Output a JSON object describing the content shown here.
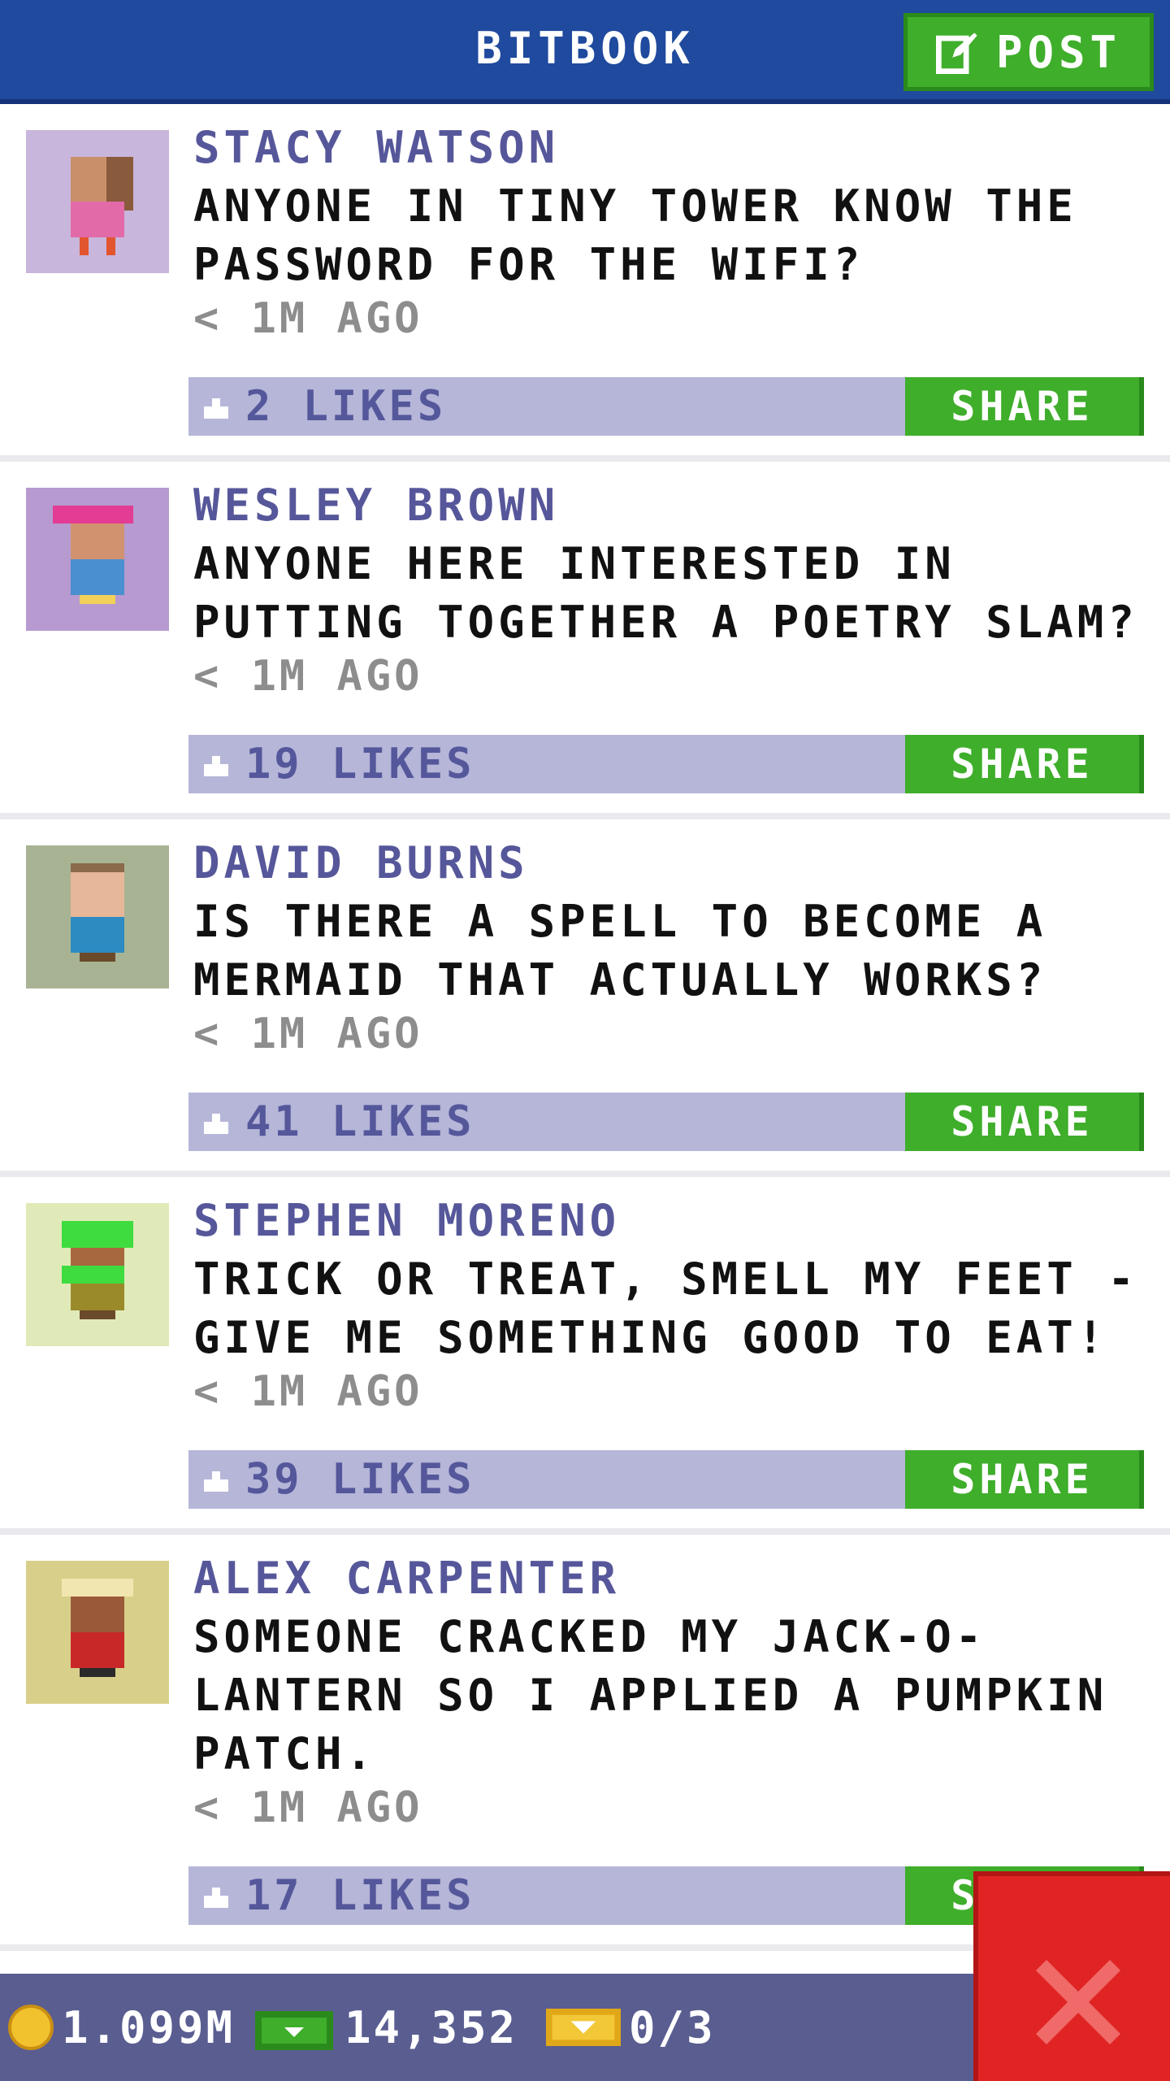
{
  "header": {
    "title": "BITBOOK",
    "post_label": "POST"
  },
  "posts": [
    {
      "author": "STACY WATSON",
      "message": "ANYONE IN TINY TOWER KNOW THE PASSWORD FOR THE WIFI?",
      "time": "< 1M AGO",
      "likes": "2 LIKES",
      "share_label": "SHARE"
    },
    {
      "author": "WESLEY BROWN",
      "message": "ANYONE HERE INTERESTED IN PUTTING TOGETHER A POETRY SLAM?",
      "time": "< 1M AGO",
      "likes": "19 LIKES",
      "share_label": "SHARE"
    },
    {
      "author": "DAVID BURNS",
      "message": "IS THERE A SPELL TO BECOME A MERMAID THAT ACTUALLY WORKS?",
      "time": "< 1M AGO",
      "likes": "41 LIKES",
      "share_label": "SHARE"
    },
    {
      "author": "STEPHEN MORENO",
      "message": "TRICK OR TREAT, SMELL MY FEET - GIVE ME SOMETHING GOOD TO EAT!",
      "time": "< 1M AGO",
      "likes": "39 LIKES",
      "share_label": "SHARE"
    },
    {
      "author": "ALEX CARPENTER",
      "message": "SOMEONE CRACKED MY JACK-O-LANTERN SO I APPLIED A PUMPKIN PATCH.",
      "time": "< 1M AGO",
      "likes": "17 LIKES",
      "share_label": "SHARE"
    }
  ],
  "footer": {
    "coins": "1.099M",
    "bux": "14,352",
    "tickets": "0/3"
  },
  "icons": {
    "post": "edit-icon",
    "like": "thumbs-up-icon",
    "coin": "coin-icon",
    "bux": "bux-icon",
    "ticket": "ticket-icon",
    "close": "close-icon"
  },
  "colors": {
    "header": "#1f4a9e",
    "accent_green": "#3fae2b",
    "like_bar": "#b5b6d8",
    "author_text": "#56579a",
    "close_red": "#e02424",
    "footer": "#5a5d90"
  }
}
